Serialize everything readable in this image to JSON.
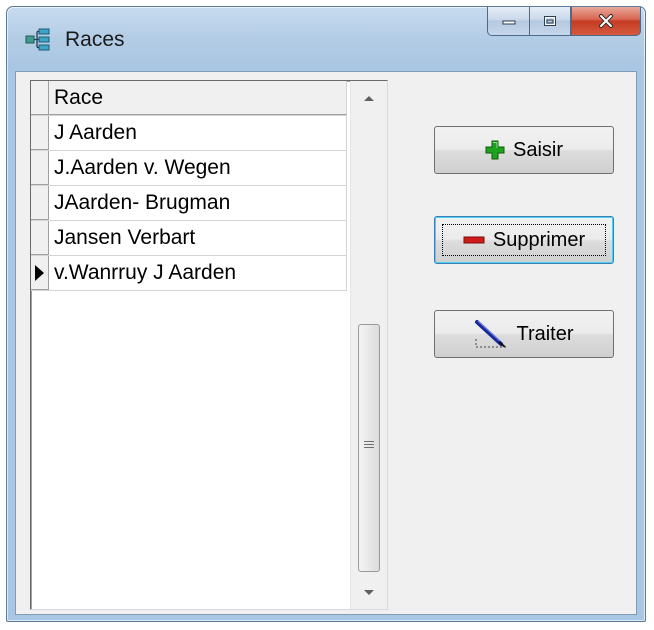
{
  "window": {
    "title": "Races"
  },
  "grid": {
    "column_header": "Race",
    "rows": [
      {
        "value": "J Aarden",
        "current": false
      },
      {
        "value": "J.Aarden v. Wegen",
        "current": false
      },
      {
        "value": "JAarden- Brugman",
        "current": false
      },
      {
        "value": "Jansen Verbart",
        "current": false
      },
      {
        "value": "v.Wanrruy J Aarden",
        "current": true
      }
    ]
  },
  "buttons": {
    "saisir": {
      "label": "Saisir",
      "icon": "green-plus-icon"
    },
    "supprimer": {
      "label": "Supprimer",
      "icon": "red-minus-icon"
    },
    "traiter": {
      "label": "Traiter",
      "icon": "pen-ruler-icon"
    }
  },
  "colors": {
    "plus": "#1fa31f",
    "minus": "#d11a1a",
    "focus": "#48d0f7"
  }
}
